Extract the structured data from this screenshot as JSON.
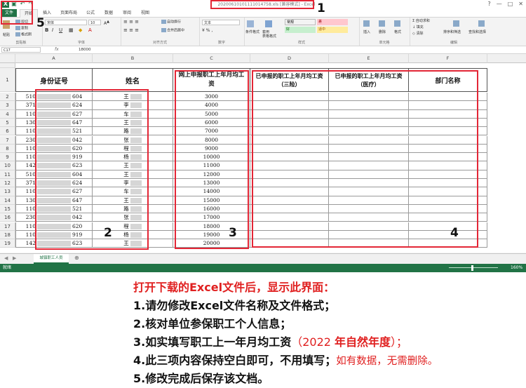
{
  "window": {
    "title": "20200610101111014758.xls [兼容模式] - Excel",
    "controls": [
      "?",
      "—",
      "□",
      "✕"
    ]
  },
  "tabs": [
    "文件",
    "开始",
    "插入",
    "页面布局",
    "公式",
    "数据",
    "审阅",
    "视图"
  ],
  "ribbon": {
    "clipboard": {
      "label": "剪贴板",
      "paste": "粘贴",
      "cut": "剪切",
      "copy": "复制",
      "format_painter": "格式刷"
    },
    "font": {
      "label": "字体",
      "font_name": "宋体",
      "font_size": "10"
    },
    "alignment": {
      "label": "对齐方式",
      "wrap": "自动换行",
      "merge": "合并后居中"
    },
    "number": {
      "label": "数字",
      "format": "文本"
    },
    "styles": {
      "label": "样式",
      "conditional": "条件格式",
      "table": "套用\n表格格式",
      "cells": [
        {
          "text": "常规",
          "bg": "#ffffff",
          "fg": "#000000"
        },
        {
          "text": "差",
          "bg": "#ffc7ce",
          "fg": "#9c0006"
        },
        {
          "text": "好",
          "bg": "#c6efce",
          "fg": "#006100"
        },
        {
          "text": "适中",
          "bg": "#ffeb9c",
          "fg": "#9c5700"
        }
      ]
    },
    "cells_group": {
      "label": "单元格",
      "insert": "插入",
      "delete": "删除",
      "format": "格式"
    },
    "editing": {
      "label": "编辑",
      "autosum": "自动求和",
      "fill": "填充",
      "clear": "清除",
      "sort": "排序和筛选",
      "find": "查找和选择"
    }
  },
  "formula_bar": {
    "name_box": "C17",
    "fx": "fx",
    "value": "18000"
  },
  "columns": [
    "A",
    "B",
    "C",
    "D",
    "E",
    "F"
  ],
  "headers": [
    "身份证号",
    "姓名",
    "网上申报职工上年月均工资",
    "已申报的职工上年月均工资（三险）",
    "已申报的职工上年月均工资（医疗）",
    "部门名称"
  ],
  "rows": [
    {
      "n": "2",
      "id_start": "510",
      "id_end": "604",
      "name": "王"
    },
    {
      "n": "3",
      "id_start": "371",
      "id_end": "624",
      "name": "李"
    },
    {
      "n": "4",
      "id_start": "110",
      "id_end": "627",
      "name": "车"
    },
    {
      "n": "5",
      "id_start": "130",
      "id_end": "647",
      "name": "王"
    },
    {
      "n": "6",
      "id_start": "110",
      "id_end": "521",
      "name": "路"
    },
    {
      "n": "7",
      "id_start": "230",
      "id_end": "042",
      "name": "张"
    },
    {
      "n": "8",
      "id_start": "110",
      "id_end": "620",
      "name": "程"
    },
    {
      "n": "9",
      "id_start": "110",
      "id_end": "919",
      "name": "杨"
    },
    {
      "n": "10",
      "id_start": "142",
      "id_end": "623",
      "name": "王"
    },
    {
      "n": "11",
      "id_start": "510",
      "id_end": "604",
      "name": "王"
    },
    {
      "n": "12",
      "id_start": "371",
      "id_end": "624",
      "name": "李"
    },
    {
      "n": "13",
      "id_start": "110",
      "id_end": "627",
      "name": "车"
    },
    {
      "n": "14",
      "id_start": "130",
      "id_end": "647",
      "name": "王"
    },
    {
      "n": "15",
      "id_start": "110",
      "id_end": "521",
      "name": "路"
    },
    {
      "n": "16",
      "id_start": "230",
      "id_end": "042",
      "name": "张"
    },
    {
      "n": "17",
      "id_start": "110",
      "id_end": "620",
      "name": "程"
    },
    {
      "n": "18",
      "id_start": "110",
      "id_end": "919",
      "name": "杨"
    },
    {
      "n": "19",
      "id_start": "142",
      "id_end": "623",
      "name": "王"
    }
  ],
  "wages": [
    "3000",
    "4000",
    "5000",
    "6000",
    "7000",
    "8000",
    "9000",
    "10000",
    "11000",
    "12000",
    "13000",
    "14000",
    "15000",
    "16000",
    "17000",
    "18000",
    "19000",
    "20000"
  ],
  "sheet_tab": "城镇职工人员",
  "status": {
    "ready": "就绪",
    "zoom": "160%"
  },
  "callouts": [
    "1",
    "2",
    "3",
    "4",
    "5"
  ],
  "instructions": {
    "title": "打开下载的Excel文件后，显示此界面：",
    "line1": "1.请勿修改Excel文件名称及文件格式；",
    "line2": "2.核对单位参保职工个人信息；",
    "line3_a": "3.如实填写职工上一年月均工资",
    "line3_b": "（2022 ",
    "line3_c": "年自然年度",
    "line3_d": "）；",
    "line4_a": "4.此三项内容保持空白即可，不用填写；",
    "line4_b": "如有数据，无需删除。",
    "line5": "5.修改完成后保存该文档。"
  },
  "colors": {
    "excel_green": "#217346",
    "callout_red": "#e32636",
    "title_red": "#e02020"
  }
}
